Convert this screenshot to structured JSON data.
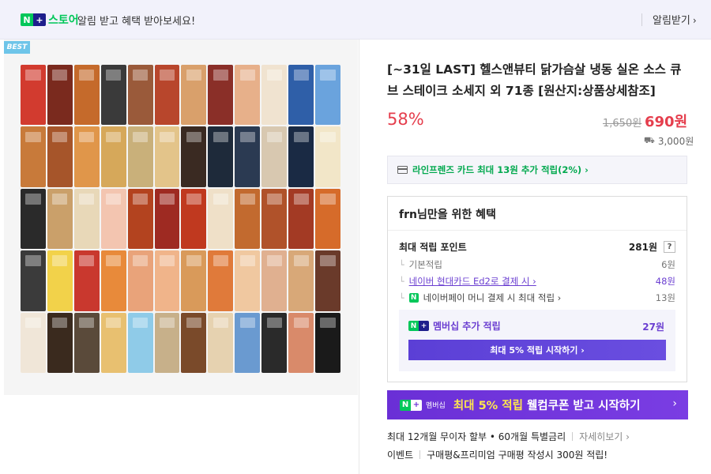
{
  "banner": {
    "brand_n": "N",
    "brand_plus": "+",
    "store_label": "스토어",
    "message": "알림 받고 혜택 받아보세요!",
    "alarm_button": "알림받기",
    "chevron": "›"
  },
  "image": {
    "best_tag": "BEST",
    "tile_colors": [
      "#d23b2f",
      "#7a2a1e",
      "#c56a2b",
      "#3a3a3a",
      "#9a5a3a",
      "#b8462c",
      "#d9a06b",
      "#8a2f28",
      "#e7b08a",
      "#f0e3d0",
      "#2f5fa8",
      "#6aa3dd",
      "#c87a3a",
      "#a6552a",
      "#e0964a",
      "#d6a85a",
      "#c9b07a",
      "#e3c48a",
      "#3a2a22",
      "#1e2a3a",
      "#2b3a52",
      "#d8c8b0",
      "#1a2a44",
      "#f2e6c8",
      "#2a2a2a",
      "#caa06a",
      "#e8d8b8",
      "#f3c5b0",
      "#b3431f",
      "#9e2a22",
      "#c0391f",
      "#efe0c8",
      "#c26a2f",
      "#b0522a",
      "#a33a24",
      "#d66b2a",
      "#3b3b3b",
      "#f2d24a",
      "#c9382e",
      "#e88a3a",
      "#e9a37a",
      "#f0b48a",
      "#d99a5a",
      "#e07a3a",
      "#f0c8a0",
      "#e0b090",
      "#d8a878",
      "#6a3a2a",
      "#f0e6d8",
      "#3a2a1e",
      "#5a4a3a",
      "#e8c070",
      "#8fcbe8",
      "#c7b08a",
      "#7a4a2a",
      "#e6d2b0",
      "#6a9ad0",
      "#2a2a2a",
      "#d98a6a",
      "#1a1a1a"
    ]
  },
  "product": {
    "title": "[~31일 LAST] 헬스앤뷰티 닭가슴살 냉동 실온 소스 큐브 스테이크 소세지 외 71종 [원산지:상품상세참조]",
    "discount": "58%",
    "original_price": "1,650원",
    "sale_price": "690원",
    "shipping_fee": "3,000원",
    "truck_icon": "truck-icon"
  },
  "card_benefit": {
    "text": "라인프렌즈 카드 최대 13원 추가 적립(2%) ›"
  },
  "benefits": {
    "title": "frn님만을 위한 혜택",
    "max_points_label": "최대 적립 포인트",
    "max_points_value": "281원",
    "help": "?",
    "basic_label": "기본적립",
    "basic_value": "6원",
    "hyundai_label": "네이버 현대카드 Ed2로 결제 시 ›",
    "hyundai_value": "48원",
    "npay_label": "네이버페이 머니 결제 시 최대 적립 ›",
    "npay_value": "13원",
    "npay_badge": "N",
    "tree_glyph": "└",
    "membership_label": "멤버십 추가 적립",
    "membership_value": "27원",
    "membership_button": "최대 5% 적립 시작하기 ›"
  },
  "promo": {
    "member_tag": "멤버십",
    "text_highlight": "최대 5% 적립",
    "text_rest": " 웰컴쿠폰 받고 시작하기",
    "chevron": "›"
  },
  "info": {
    "installment": "최대 12개월 무이자 할부 • 60개월 특별금리",
    "detail_link": "자세히보기 ›",
    "event_label": "이벤트",
    "event_text": "구매평&프리미엄 구매평 작성시 300원 적립!"
  }
}
